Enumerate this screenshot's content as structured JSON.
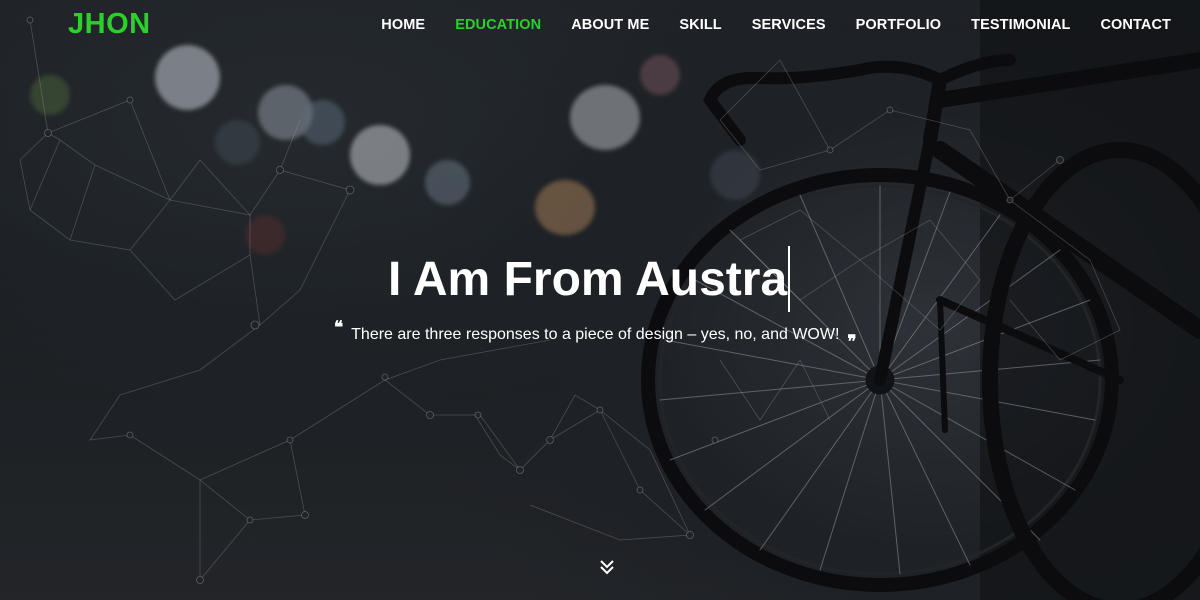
{
  "brand": {
    "logo_text": "JHON",
    "accent_color": "#2bd02b"
  },
  "nav": {
    "items": [
      {
        "label": "HOME",
        "active": false
      },
      {
        "label": "EDUCATION",
        "active": true
      },
      {
        "label": "ABOUT ME",
        "active": false
      },
      {
        "label": "SKILL",
        "active": false
      },
      {
        "label": "SERVICES",
        "active": false
      },
      {
        "label": "PORTFOLIO",
        "active": false
      },
      {
        "label": "TESTIMONIAL",
        "active": false
      },
      {
        "label": "CONTACT",
        "active": false
      }
    ]
  },
  "hero": {
    "headline": "I Am From Austra",
    "quote_text": "There are three responses to a piece of design – yes, no, and WOW!",
    "quote_open_mark": "❝",
    "quote_close_mark": "❞",
    "background_image": "bicycle-icon",
    "scroll_icon": "double-chevron-down-icon"
  }
}
